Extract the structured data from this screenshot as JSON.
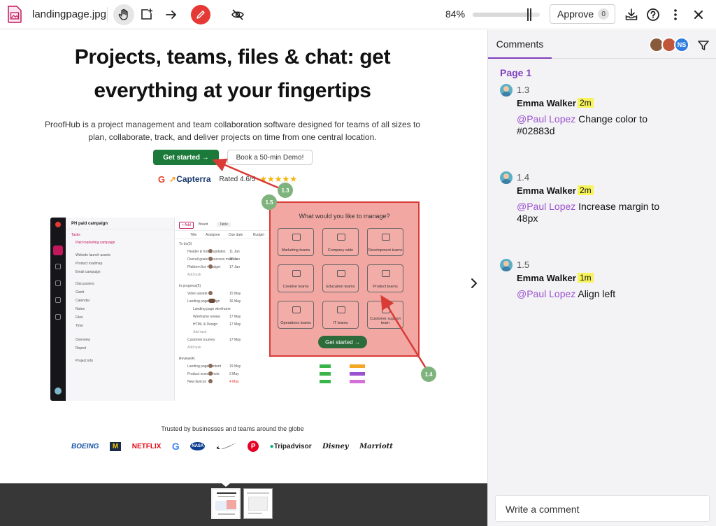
{
  "toolbar": {
    "file_name": "landingpage.jpg",
    "zoom": "84%",
    "zoom_level": 0.84,
    "approve_label": "Approve",
    "approve_count": "0"
  },
  "canvas": {
    "hero_title_line1": "Projects, teams, files & chat: get",
    "hero_title_line2": "everything at your fingertips",
    "hero_sub_line1": "ProofHub is a project management and team collaboration software designed for teams of all sizes to",
    "hero_sub_line2": "plan, collaborate, track, and deliver projects on time from one central location.",
    "cta_primary": "Get started →",
    "cta_secondary": "Book a 50-min Demo!",
    "g2": "G",
    "capterra": "Capterra",
    "rated": "Rated 4.6/5",
    "stars": "★★★★★",
    "app": {
      "project": "PH paid campaign",
      "add": "+ Add",
      "board": "Board",
      "table": "Table",
      "sidebar_items": [
        "Tasks",
        "Paid marketing campaign",
        "Website launch assets",
        "Product roadmap",
        "Email campaign",
        "Discussions",
        "Gantt",
        "Calendar",
        "Notes",
        "Files",
        "Time",
        "Overview",
        "Report",
        "Project info"
      ],
      "columns": [
        "Title",
        "Assignee",
        "Due date",
        "Budget"
      ],
      "groups": [
        "To do(3)",
        "In progress(5)",
        "Review(4)"
      ],
      "rows": [
        "Header & footer updates",
        "Overall goals & success metrics",
        "Platform list + budget",
        "Add task",
        "Video assets",
        "Landing page design",
        "Landing page wireframe",
        "Wireframe review",
        "HTML & Design",
        "Add task",
        "Customer journey",
        "Add task",
        "Landing page content",
        "Product screenshots",
        "New favicon"
      ],
      "dates": [
        "11 Jan",
        "10 Jan",
        "17 Jan",
        "15 May",
        "16 May",
        "17 May",
        "17 May",
        "17 May",
        "19 May",
        "3 May",
        "4 May",
        "17 May"
      ]
    },
    "overlay": {
      "title": "What would you like to manage?",
      "tiles": [
        "Marketing teams",
        "Company wide",
        "Development teams",
        "Creative teams",
        "Education teams",
        "Product teams",
        "Operations teams",
        "IT teams",
        "Customer support team"
      ],
      "button": "Get started →"
    },
    "pins": [
      "1.3",
      "1.5",
      "1.4"
    ],
    "trusted": "Trusted by businesses and teams around the globe",
    "logos": [
      "BOEING",
      "M",
      "NETFLIX",
      "G",
      "NASA",
      "Nike",
      "P",
      "Tripadvisor",
      "Disney",
      "Marriott"
    ]
  },
  "panel": {
    "tab": "Comments",
    "avatar_initials": "NS",
    "page_label": "Page 1",
    "comments": [
      {
        "num": "1.3",
        "author": "Emma Walker",
        "time": "2m",
        "mention": "@Paul Lopez",
        "text": "Change color to #02883d"
      },
      {
        "num": "1.4",
        "author": "Emma Walker",
        "time": "2m",
        "mention": "@Paul Lopez",
        "text": "Increase margin to 48px"
      },
      {
        "num": "1.5",
        "author": "Emma Walker",
        "time": "1m",
        "mention": "@Paul Lopez",
        "text": "Align left"
      }
    ],
    "write_placeholder": "Write a comment"
  },
  "colors": {
    "accent_purple": "#7e3fbf",
    "mention_purple": "#9b51d0",
    "tool_red": "#e53935",
    "pin_green": "#7fb37d",
    "annotation_red": "#d93b36",
    "highlight_yellow": "#f7f35b"
  },
  "icons": [
    "image-file-icon",
    "hand-tool-icon",
    "add-comment-box-icon",
    "arrow-tool-icon",
    "pen-tool-icon",
    "hide-annotations-icon",
    "download-tray-icon",
    "help-icon",
    "more-vertical-icon",
    "close-icon",
    "filter-icon",
    "chevron-right-icon"
  ]
}
